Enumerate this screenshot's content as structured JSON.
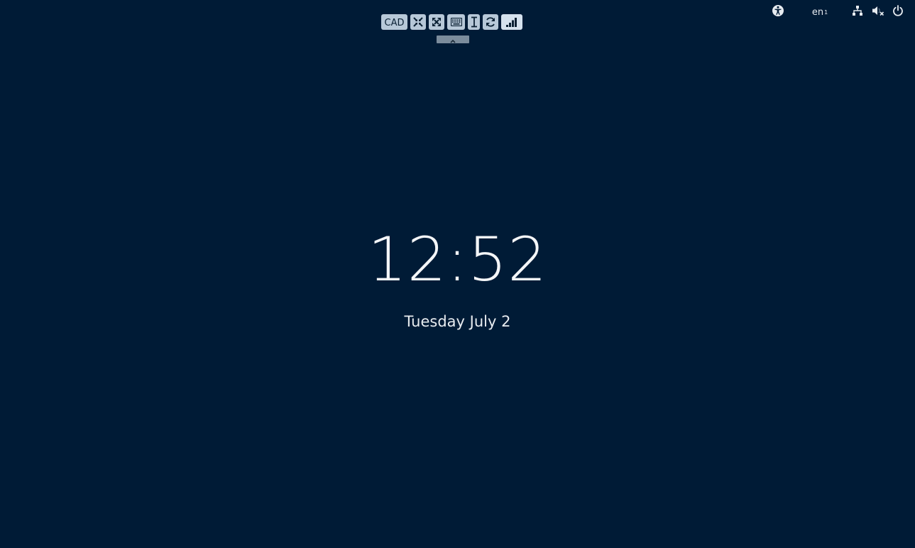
{
  "viewer_toolbar": {
    "cad_label": "CAD",
    "buttons": [
      {
        "icon": "minimize-icon"
      },
      {
        "icon": "fullscreen-icon"
      },
      {
        "icon": "keyboard-icon"
      },
      {
        "icon": "text-cursor-icon"
      },
      {
        "icon": "refresh-icon"
      },
      {
        "icon": "signal-bars-icon",
        "active": true
      }
    ],
    "collapse_icon": "chevron-up-icon"
  },
  "status_area": {
    "accessibility_icon": "accessibility-icon",
    "language": "en",
    "language_index": "1",
    "network_icon": "wired-network-icon",
    "volume_icon": "volume-muted-icon",
    "power_icon": "power-icon"
  },
  "lock_screen": {
    "time": "12:52",
    "date": "Tuesday July 2"
  },
  "colors": {
    "background": "#001b36",
    "toolbar_button": "#b7c8d8",
    "toolbar_icon": "#0a2033",
    "text": "#f4f6f8"
  }
}
